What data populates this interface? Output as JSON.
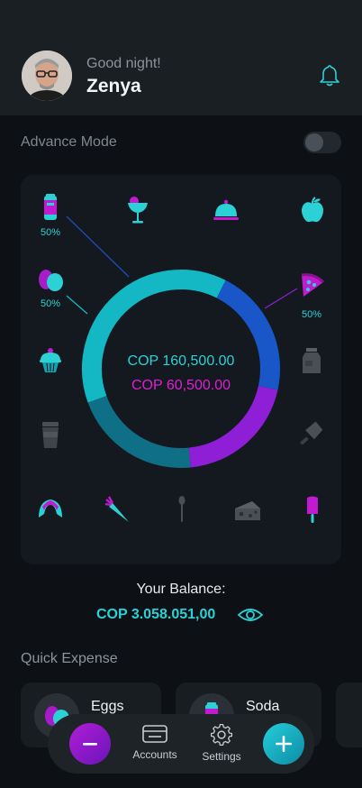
{
  "header": {
    "greeting": "Good night!",
    "username": "Zenya",
    "notification_icon": "bell-icon"
  },
  "mode": {
    "label": "Advance Mode",
    "enabled": false
  },
  "categories": [
    {
      "name": "soda-can",
      "percent": "50%"
    },
    {
      "name": "cocktail"
    },
    {
      "name": "cloche"
    },
    {
      "name": "apple"
    },
    {
      "name": "eggs",
      "percent": "50%"
    },
    {
      "name": "pizza",
      "percent": "50%"
    },
    {
      "name": "cupcake"
    },
    {
      "name": "milk-carton"
    },
    {
      "name": "coffee-cup"
    },
    {
      "name": "cleaver"
    },
    {
      "name": "croissant"
    },
    {
      "name": "carrot"
    },
    {
      "name": "spoon"
    },
    {
      "name": "cheese"
    },
    {
      "name": "popsicle"
    }
  ],
  "chart_data": {
    "type": "pie",
    "values": [
      38,
      21,
      20,
      21
    ],
    "colors": [
      "#14b8c4",
      "#1957c8",
      "#8e1fd6",
      "#0f6f86"
    ]
  },
  "totals": {
    "primary": "COP 160,500.00",
    "secondary": "COP 60,500.00"
  },
  "balance": {
    "label": "Your Balance:",
    "value": "COP 3.058.051,00",
    "toggle_icon": "eye-icon"
  },
  "quick_expense": {
    "title": "Quick Expense",
    "items": [
      {
        "label": "Eggs",
        "icon": "eggs-icon"
      },
      {
        "label": "Soda",
        "icon": "soda-can-icon"
      }
    ]
  },
  "tabbar": {
    "accounts_label": "Accounts",
    "settings_label": "Settings"
  },
  "colors": {
    "accent_cyan": "#2cd1d5",
    "accent_magenta": "#e01ed6",
    "background": "#0d1116",
    "card": "#14191f"
  }
}
